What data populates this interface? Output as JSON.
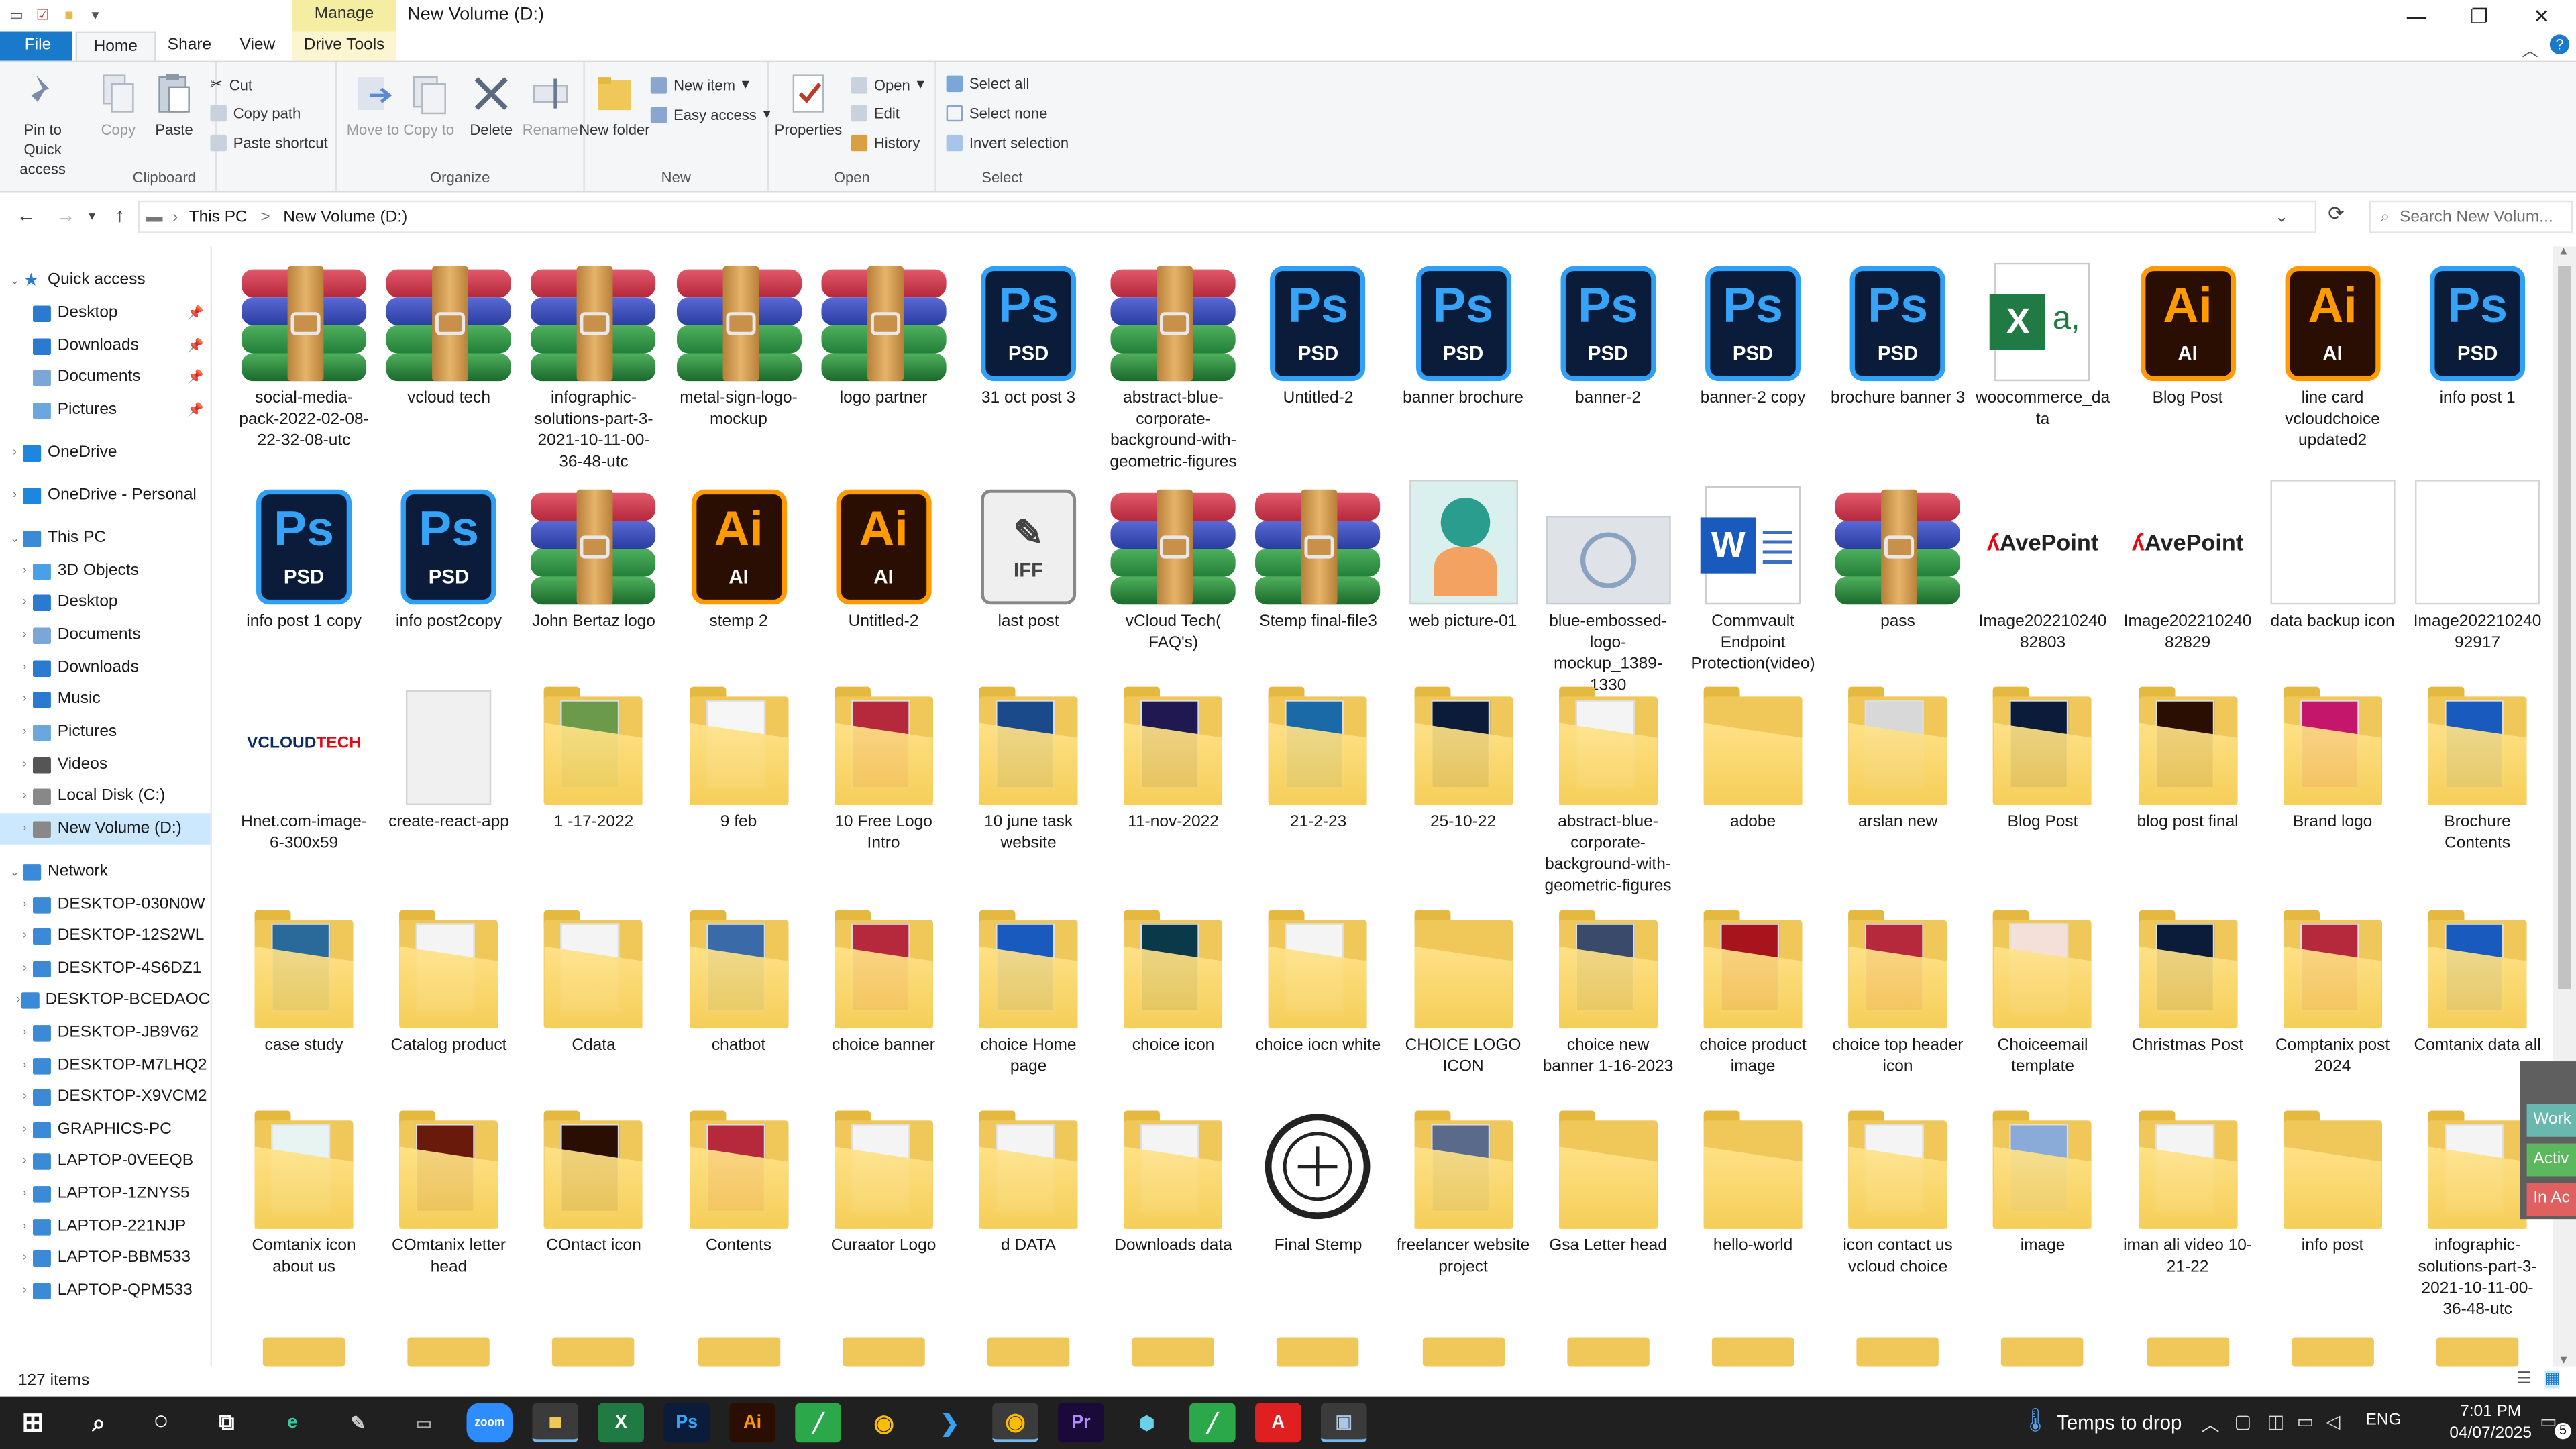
{
  "window": {
    "title": "New Volume (D:)",
    "manage_tab": "Manage",
    "minimize": "—",
    "maximize": "❐",
    "close": "✕"
  },
  "tabs": [
    "File",
    "Home",
    "Share",
    "View",
    "Drive Tools"
  ],
  "ribbon": {
    "clipboard": {
      "label": "Clipboard",
      "pin": "Pin to Quick access",
      "copy": "Copy",
      "paste": "Paste",
      "cut": "Cut",
      "copy_path": "Copy path",
      "paste_shortcut": "Paste shortcut"
    },
    "organize": {
      "label": "Organize",
      "move_to": "Move to",
      "copy_to": "Copy to",
      "delete": "Delete",
      "rename": "Rename"
    },
    "new": {
      "label": "New",
      "new_folder": "New folder",
      "new_item": "New item",
      "easy_access": "Easy access"
    },
    "open": {
      "label": "Open",
      "properties": "Properties",
      "open": "Open",
      "edit": "Edit",
      "history": "History"
    },
    "select": {
      "label": "Select",
      "select_all": "Select all",
      "select_none": "Select none",
      "invert": "Invert selection"
    }
  },
  "address": {
    "crumbs": [
      "This PC",
      ">",
      "New Volume (D:)"
    ],
    "search_placeholder": "Search New Volum..."
  },
  "nav": [
    {
      "label": "Quick access",
      "icon": "star-icon",
      "chev": "v",
      "indent": 0,
      "color": "#2a7ad2",
      "section": true
    },
    {
      "label": "Desktop",
      "icon": "desktop-icon",
      "indent": 1,
      "pin": true,
      "color": "#2a7ad2"
    },
    {
      "label": "Downloads",
      "icon": "download-icon",
      "indent": 1,
      "pin": true,
      "color": "#2a7ad2"
    },
    {
      "label": "Documents",
      "icon": "documents-icon",
      "indent": 1,
      "pin": true,
      "color": "#7aa6d8"
    },
    {
      "label": "Pictures",
      "icon": "pictures-icon",
      "indent": 1,
      "pin": true,
      "color": "#6aa6e0"
    },
    {
      "label": "OneDrive",
      "icon": "cloud-icon",
      "chev": ">",
      "indent": 0,
      "color": "#1f86e0",
      "section": true
    },
    {
      "label": "OneDrive - Personal",
      "icon": "cloud-icon",
      "chev": ">",
      "indent": 0,
      "color": "#1f86e0",
      "section": true
    },
    {
      "label": "This PC",
      "icon": "computer-icon",
      "chev": "v",
      "indent": 0,
      "color": "#3a8ad8",
      "section": true
    },
    {
      "label": "3D Objects",
      "icon": "cube-icon",
      "chev": ">",
      "indent": 1,
      "color": "#4aa0e8"
    },
    {
      "label": "Desktop",
      "icon": "desktop-icon",
      "chev": ">",
      "indent": 1,
      "color": "#2a7ad2"
    },
    {
      "label": "Documents",
      "icon": "documents-icon",
      "chev": ">",
      "indent": 1,
      "color": "#7aa6d8"
    },
    {
      "label": "Downloads",
      "icon": "download-icon",
      "chev": ">",
      "indent": 1,
      "color": "#2a7ad2"
    },
    {
      "label": "Music",
      "icon": "music-icon",
      "chev": ">",
      "indent": 1,
      "color": "#2a7ad2"
    },
    {
      "label": "Pictures",
      "icon": "pictures-icon",
      "chev": ">",
      "indent": 1,
      "color": "#6aa6e0"
    },
    {
      "label": "Videos",
      "icon": "videos-icon",
      "chev": ">",
      "indent": 1,
      "color": "#555"
    },
    {
      "label": "Local Disk (C:)",
      "icon": "drive-icon",
      "chev": ">",
      "indent": 1,
      "color": "#888"
    },
    {
      "label": "New Volume (D:)",
      "icon": "drive-icon",
      "chev": ">",
      "indent": 1,
      "color": "#888",
      "selected": true
    },
    {
      "label": "Network",
      "icon": "network-icon",
      "chev": "v",
      "indent": 0,
      "color": "#3a8ad8",
      "section": true
    },
    {
      "label": "DESKTOP-030N0W",
      "icon": "pc-icon",
      "chev": ">",
      "indent": 1,
      "color": "#3a8ad8"
    },
    {
      "label": "DESKTOP-12S2WL",
      "icon": "pc-icon",
      "chev": ">",
      "indent": 1,
      "color": "#3a8ad8"
    },
    {
      "label": "DESKTOP-4S6DZ1",
      "icon": "pc-icon",
      "chev": ">",
      "indent": 1,
      "color": "#3a8ad8"
    },
    {
      "label": "DESKTOP-BCEDAOC",
      "icon": "pc-icon",
      "chev": ">",
      "indent": 1,
      "color": "#3a8ad8"
    },
    {
      "label": "DESKTOP-JB9V62",
      "icon": "pc-icon",
      "chev": ">",
      "indent": 1,
      "color": "#3a8ad8"
    },
    {
      "label": "DESKTOP-M7LHQ2",
      "icon": "pc-icon",
      "chev": ">",
      "indent": 1,
      "color": "#3a8ad8"
    },
    {
      "label": "DESKTOP-X9VCM2",
      "icon": "pc-icon",
      "chev": ">",
      "indent": 1,
      "color": "#3a8ad8"
    },
    {
      "label": "GRAPHICS-PC",
      "icon": "pc-icon",
      "chev": ">",
      "indent": 1,
      "color": "#3a8ad8"
    },
    {
      "label": "LAPTOP-0VEEQB",
      "icon": "pc-icon",
      "chev": ">",
      "indent": 1,
      "color": "#3a8ad8"
    },
    {
      "label": "LAPTOP-1ZNYS5",
      "icon": "pc-icon",
      "chev": ">",
      "indent": 1,
      "color": "#3a8ad8"
    },
    {
      "label": "LAPTOP-221NJP",
      "icon": "pc-icon",
      "chev": ">",
      "indent": 1,
      "color": "#3a8ad8"
    },
    {
      "label": "LAPTOP-BBM533",
      "icon": "pc-icon",
      "chev": ">",
      "indent": 1,
      "color": "#3a8ad8"
    },
    {
      "label": "LAPTOP-QPM533",
      "icon": "pc-icon",
      "chev": ">",
      "indent": 1,
      "color": "#3a8ad8"
    }
  ],
  "files": [
    [
      {
        "name": "social-media-pack-2022-02-08-22-32-08-utc",
        "type": "rar"
      },
      {
        "name": "vcloud tech",
        "type": "rar"
      },
      {
        "name": "infographic-solutions-part-3-2021-10-11-00-36-48-utc",
        "type": "rar"
      },
      {
        "name": "metal-sign-logo-mockup",
        "type": "rar"
      },
      {
        "name": "logo partner",
        "type": "rar"
      },
      {
        "name": "31 oct post 3",
        "type": "psd"
      },
      {
        "name": "abstract-blue-corporate-background-with-geometric-figures",
        "type": "rar"
      },
      {
        "name": "Untitled-2",
        "type": "psd"
      },
      {
        "name": "banner brochure",
        "type": "psd"
      },
      {
        "name": "banner-2",
        "type": "psd"
      },
      {
        "name": "banner-2 copy",
        "type": "psd"
      },
      {
        "name": "brochure banner 3",
        "type": "psd"
      },
      {
        "name": "woocommerce_data",
        "type": "xls"
      },
      {
        "name": "Blog Post",
        "type": "ai"
      },
      {
        "name": "line card vcloudchoice updated2",
        "type": "ai"
      },
      {
        "name": "info post 1",
        "type": "psd"
      }
    ],
    [
      {
        "name": "info post 1 copy",
        "type": "psd"
      },
      {
        "name": "info post2copy",
        "type": "psd"
      },
      {
        "name": "John Bertaz logo",
        "type": "rar"
      },
      {
        "name": "stemp 2",
        "type": "ai"
      },
      {
        "name": "Untitled-2",
        "type": "ai"
      },
      {
        "name": "last post",
        "type": "iff"
      },
      {
        "name": "vCloud Tech( FAQ's)",
        "type": "rar"
      },
      {
        "name": "Stemp final-file3",
        "type": "rar"
      },
      {
        "name": "web picture-01",
        "type": "webpic"
      },
      {
        "name": "blue-embossed-logo-mockup_1389-1330",
        "type": "embossed"
      },
      {
        "name": "Commvault Endpoint Protection(video)",
        "type": "word"
      },
      {
        "name": "pass",
        "type": "rar"
      },
      {
        "name": "Image20221024082803",
        "type": "avepoint"
      },
      {
        "name": "Image20221024082829",
        "type": "avepoint"
      },
      {
        "name": "data backup icon",
        "type": "blank"
      },
      {
        "name": "Image20221024092917",
        "type": "blank"
      }
    ],
    [
      {
        "name": "Hnet.com-image-6-300x59",
        "type": "vcloud"
      },
      {
        "name": "create-react-app",
        "type": "plain"
      },
      {
        "name": "1 -17-2022",
        "type": "folder",
        "pv": "#6a9a4a"
      },
      {
        "name": "9 feb",
        "type": "folder",
        "pv": "#f6f6f6"
      },
      {
        "name": "10 Free Logo Intro",
        "type": "folder",
        "pv": "#b6283c"
      },
      {
        "name": "10 june task website",
        "type": "folder",
        "pv": "#1a4a8a"
      },
      {
        "name": "11-nov-2022",
        "type": "folder",
        "pv": "#201850"
      },
      {
        "name": "21-2-23",
        "type": "folder",
        "pv": "#1a6aa8"
      },
      {
        "name": "25-10-22",
        "type": "folder",
        "pv": "#0b1c3a"
      },
      {
        "name": "abstract-blue-corporate-background-with-geometric-figures",
        "type": "folder",
        "pv": "#f4f4f4"
      },
      {
        "name": "adobe",
        "type": "folder",
        "pv": ""
      },
      {
        "name": "arslan new",
        "type": "folder",
        "pv": "#d8d8d8"
      },
      {
        "name": "Blog Post",
        "type": "folder",
        "pv": "#0b1c3a"
      },
      {
        "name": "blog post final",
        "type": "folder",
        "pv": "#2b0e02"
      },
      {
        "name": "Brand logo",
        "type": "folder",
        "pv": "#c4166a"
      },
      {
        "name": "Brochure Contents",
        "type": "folder",
        "pv": "#185abd"
      }
    ],
    [
      {
        "name": "case study",
        "type": "folder",
        "pv": "#2a6a9a"
      },
      {
        "name": "Catalog product",
        "type": "folder",
        "pv": "#f4f4f4"
      },
      {
        "name": "Cdata",
        "type": "folder",
        "pv": "#f4f4f4"
      },
      {
        "name": "chatbot",
        "type": "folder",
        "pv": "#3a6aa8"
      },
      {
        "name": "choice banner",
        "type": "folder",
        "pv": "#b6283c"
      },
      {
        "name": "choice Home page",
        "type": "folder",
        "pv": "#185abd"
      },
      {
        "name": "choice icon",
        "type": "folder",
        "pv": "#0a3a4a"
      },
      {
        "name": "choice iocn white",
        "type": "folder",
        "pv": "#f4f4f4"
      },
      {
        "name": "CHOICE LOGO ICON",
        "type": "folder",
        "pv": ""
      },
      {
        "name": "choice new banner 1-16-2023",
        "type": "folder",
        "pv": "#3a4a6a"
      },
      {
        "name": "choice product image",
        "type": "folder",
        "pv": "#a8141c"
      },
      {
        "name": "choice top header icon",
        "type": "folder",
        "pv": "#b6283c"
      },
      {
        "name": "Choiceemail template",
        "type": "folder",
        "pv": "#f4e0d8"
      },
      {
        "name": "Christmas Post",
        "type": "folder",
        "pv": "#0b1c3a"
      },
      {
        "name": "Comptanix post 2024",
        "type": "folder",
        "pv": "#b6283c"
      },
      {
        "name": "Comtanix data all",
        "type": "folder",
        "pv": "#185abd"
      }
    ],
    [
      {
        "name": "Comtanix icon about us",
        "type": "folder",
        "pv": "#e8f4f2"
      },
      {
        "name": "COmtanix letter head",
        "type": "folder",
        "pv": "#6a1a0a"
      },
      {
        "name": "COntact icon",
        "type": "folder",
        "pv": "#2b0e02"
      },
      {
        "name": "Contents",
        "type": "folder",
        "pv": "#b6283c"
      },
      {
        "name": "Curaator Logo",
        "type": "folder",
        "pv": "#f4f4f4"
      },
      {
        "name": "d  DATA",
        "type": "folder",
        "pv": "#f4f4f4"
      },
      {
        "name": "Downloads data",
        "type": "folder",
        "pv": "#f4f4f4"
      },
      {
        "name": "Final Stemp",
        "type": "stamp"
      },
      {
        "name": "freelancer website project",
        "type": "folder",
        "pv": "#5a6a8a"
      },
      {
        "name": "Gsa Letter head",
        "type": "folder",
        "pv": ""
      },
      {
        "name": "hello-world",
        "type": "folder",
        "pv": ""
      },
      {
        "name": "icon contact us vcloud choice",
        "type": "folder",
        "pv": "#f4f4f4"
      },
      {
        "name": "image",
        "type": "folder",
        "pv": "#8aaad8"
      },
      {
        "name": "iman ali video 10-21-22",
        "type": "folder",
        "pv": "#f4f4f4"
      },
      {
        "name": "info post",
        "type": "folder",
        "pv": ""
      },
      {
        "name": "infographic-solutions-part-3-2021-10-11-00-36-48-utc",
        "type": "folder",
        "pv": "#f4f4f4"
      }
    ]
  ],
  "status": {
    "items": "127 items"
  },
  "taskbar": {
    "temps": "Temps to drop",
    "lang": "ENG",
    "time": "7:01 PM",
    "date": "04/07/2025",
    "badge": "5"
  },
  "sidetabs": [
    "Work",
    "Activ",
    "In Ac"
  ],
  "colors": {
    "accent": "#1979ca",
    "folder": "#f0c85a",
    "ps": "#35a3f8",
    "ai": "#ff9a00"
  }
}
